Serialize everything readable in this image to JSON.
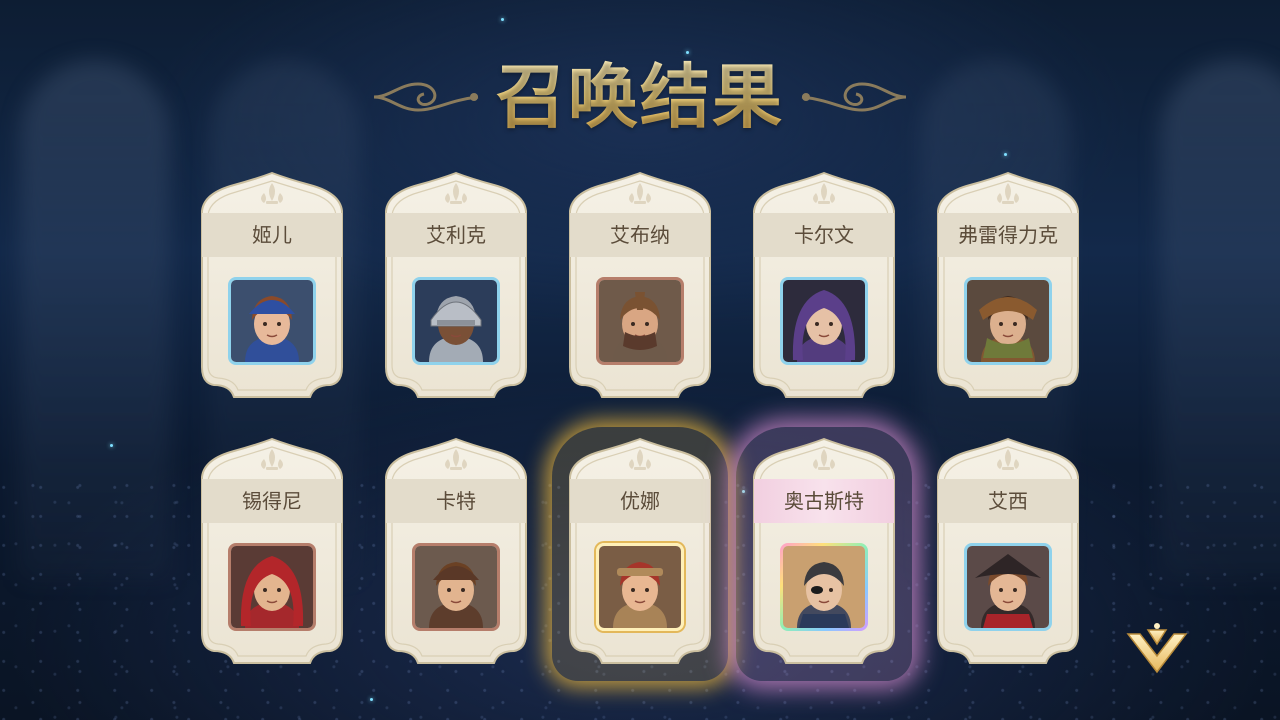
{
  "screen": {
    "title": "召唤结果"
  },
  "results": [
    {
      "name": "姬儿",
      "frame": "blue",
      "highlight": "none",
      "icon": "portrait-blue-hat-woman"
    },
    {
      "name": "艾利克",
      "frame": "blue",
      "highlight": "none",
      "icon": "portrait-knight-helmet"
    },
    {
      "name": "艾布纳",
      "frame": "brown",
      "highlight": "none",
      "icon": "portrait-masked-mohawk"
    },
    {
      "name": "卡尔文",
      "frame": "blue",
      "highlight": "none",
      "icon": "portrait-purple-hood"
    },
    {
      "name": "弗雷得力克",
      "frame": "blue",
      "highlight": "none",
      "icon": "portrait-brown-hood-scarf"
    },
    {
      "name": "锡得尼",
      "frame": "brown",
      "highlight": "none",
      "icon": "portrait-red-hood"
    },
    {
      "name": "卡特",
      "frame": "brown",
      "highlight": "none",
      "icon": "portrait-feather-hat"
    },
    {
      "name": "优娜",
      "frame": "gold",
      "highlight": "gold",
      "icon": "portrait-braided-woman"
    },
    {
      "name": "奥古斯特",
      "frame": "rainbow",
      "highlight": "pink",
      "icon": "portrait-eyepatch-officer"
    },
    {
      "name": "艾西",
      "frame": "blue",
      "highlight": "none",
      "icon": "portrait-tricorn-hat"
    }
  ],
  "colors": {
    "title_gold": "#f4d57e",
    "card_parchment": "#f1ecde",
    "name_text": "#5b4c3a",
    "frame_blue": "#8fd2ec",
    "frame_brown": "#b67e6b",
    "glow_gold": "#ffc43c",
    "glow_pink": "#e696dc"
  },
  "controls": {
    "next_icon": "chevron-down-icon"
  }
}
